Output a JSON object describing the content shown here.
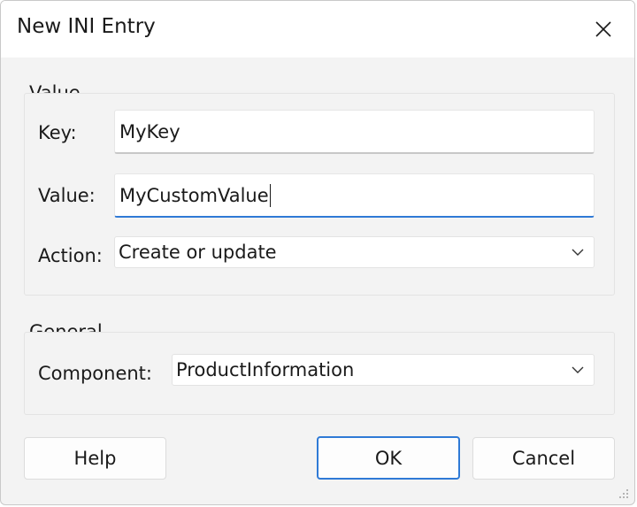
{
  "window": {
    "title": "New INI Entry"
  },
  "value_group": {
    "label": "Value",
    "key_label": "Key:",
    "key_value": "MyKey",
    "value_label": "Value:",
    "value_value": "MyCustomValue",
    "action_label": "Action:",
    "action_selected": "Create or update"
  },
  "general_group": {
    "label": "General",
    "component_label": "Component:",
    "component_selected": "ProductInformation"
  },
  "buttons": {
    "help": "Help",
    "ok": "OK",
    "cancel": "Cancel"
  },
  "colors": {
    "accent": "#2f7ad6",
    "dialog_bg": "#f3f3f3",
    "titlebar_bg": "#ffffff"
  }
}
